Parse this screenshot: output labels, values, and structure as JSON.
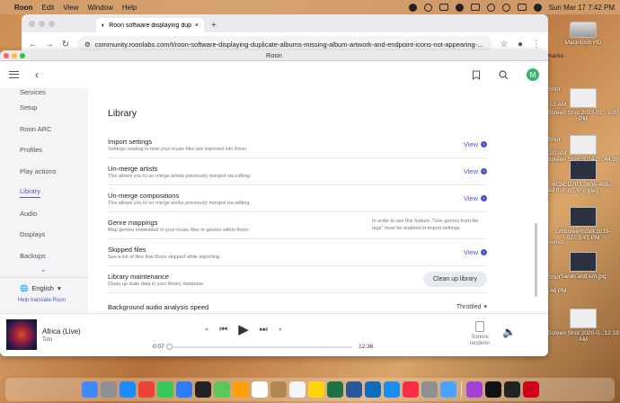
{
  "menubar": {
    "apple": "",
    "app": "Roon",
    "items": [
      "Edit",
      "View",
      "Window",
      "Help"
    ],
    "clock": "Sun Mar 17  7:42 PM"
  },
  "browser": {
    "tab_title": "Roon software displaying dup",
    "url": "community.roonlabs.com/t/roon-software-displaying-duplicate-albums-missing-album-artwork-and-endpoint-icons-not-appearing-...",
    "bookmarks_hint": "kmarks"
  },
  "roon": {
    "window_title": "Roon",
    "avatar_letter": "M",
    "sidebar": {
      "items": [
        "Services",
        "Setup",
        "Roon ARC",
        "Profiles",
        "Play actions",
        "Library",
        "Audio",
        "Displays",
        "Backups"
      ],
      "active": "Library",
      "language": "English",
      "help_link": "Help translate Roon"
    },
    "page_title": "Library",
    "settings": [
      {
        "title": "Import settings",
        "desc": "Settings relating to how your music files are imported into Roon.",
        "action": "View"
      },
      {
        "title": "Un-merge artists",
        "desc": "This allows you to un-merge artists previously merged via editing.",
        "action": "View"
      },
      {
        "title": "Un-merge compositions",
        "desc": "This allows you to un-merge works previously merged via editing.",
        "action": "View"
      },
      {
        "title": "Genre mappings",
        "desc": "Map genres embedded in your music files to genres within Roon.",
        "note": "In order to use this feature, \"Use genres from file tags\" must be enabled in import settings."
      },
      {
        "title": "Skipped files",
        "desc": "See a list of files that Roon skipped while importing.",
        "action": "View"
      },
      {
        "title": "Library maintenance",
        "desc": "Clean up stale data in your library database.",
        "button": "Clean up library"
      },
      {
        "title": "Background audio analysis speed",
        "desc": "",
        "select": "Throttled"
      }
    ],
    "player": {
      "track": "Africa (Live)",
      "artist": "Toto",
      "elapsed": "0:07",
      "duration": "12:36",
      "progress_fraction": 0.009,
      "zone": "Sonore renderer"
    }
  },
  "desktop": {
    "icons": [
      "Macintosh HD",
      "Screen Shot 2023-01...9.03 PM",
      "Screen Shot 2024-0...44.06 PM",
      "8C8CD703-280A-4892-B...5_c.jpeg",
      "LWScreenShot 2019-02...3.41 PM",
      "Sarah and em.jpg",
      "Screen Shot 2020-0...12.19 AM"
    ],
    "strip": [
      "Shot",
      ".01 AM",
      "Shot",
      ".20 AM",
      "ad trip",
      "series",
      "Shot",
      ".46 PM"
    ]
  },
  "dock": {
    "apps": [
      "Finder",
      "Launchpad",
      "Safari",
      "Chrome",
      "Messages",
      "Mail",
      "Roon",
      "Maps",
      "Photos",
      "Calendar",
      "Contacts",
      "Reminders",
      "Notes",
      "Excel",
      "Word",
      "Outlook",
      "App Store",
      "Music",
      "System Settings",
      "Preview",
      "Podcasts",
      "TV",
      "Terminal",
      "Adobe"
    ]
  }
}
